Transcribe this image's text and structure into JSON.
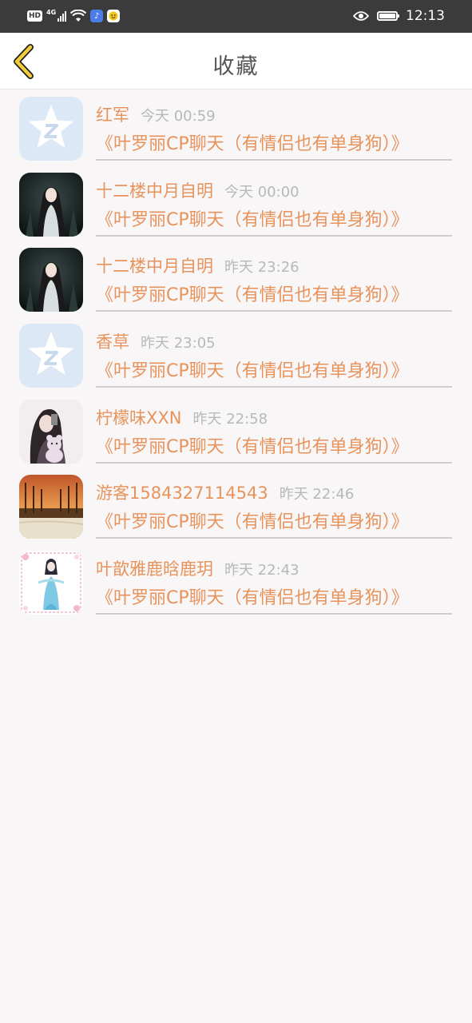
{
  "status_bar": {
    "left_badges": [
      "HD",
      "4G"
    ],
    "time": "12:13"
  },
  "header": {
    "title": "收藏",
    "back_icon": "chevron-left-icon",
    "accent_color": "#f2cf3a"
  },
  "favorites": [
    {
      "name": "红军",
      "time": "今天 00:59",
      "room": "《叶罗丽CP聊天（有情侣也有单身狗）》",
      "avatar": "default-star-avatar"
    },
    {
      "name": "十二楼中月自明",
      "time": "今天 00:00",
      "room": "《叶罗丽CP聊天（有情侣也有单身狗）》",
      "avatar": "anime-girl-avatar"
    },
    {
      "name": "十二楼中月自明",
      "time": "昨天 23:26",
      "room": "《叶罗丽CP聊天（有情侣也有单身狗）》",
      "avatar": "anime-girl-avatar"
    },
    {
      "name": "香草",
      "time": "昨天 23:05",
      "room": "《叶罗丽CP聊天（有情侣也有单身狗）》",
      "avatar": "default-star-avatar"
    },
    {
      "name": "柠檬味XXN",
      "time": "昨天 22:58",
      "room": "《叶罗丽CP聊天（有情侣也有单身狗）》",
      "avatar": "girl-with-teddy-avatar"
    },
    {
      "name": "游客1584327114543",
      "time": "昨天 22:46",
      "room": "《叶罗丽CP聊天（有情侣也有单身狗）》",
      "avatar": "autumn-forest-avatar"
    },
    {
      "name": "叶歆雅鹿晗鹿玥",
      "time": "昨天 22:43",
      "room": "《叶罗丽CP聊天（有情侣也有单身狗）》",
      "avatar": "fairy-doll-avatar"
    }
  ],
  "colors": {
    "name_color": "#e8935c",
    "time_color": "#b8b8b8",
    "background": "#f8f6f7"
  }
}
